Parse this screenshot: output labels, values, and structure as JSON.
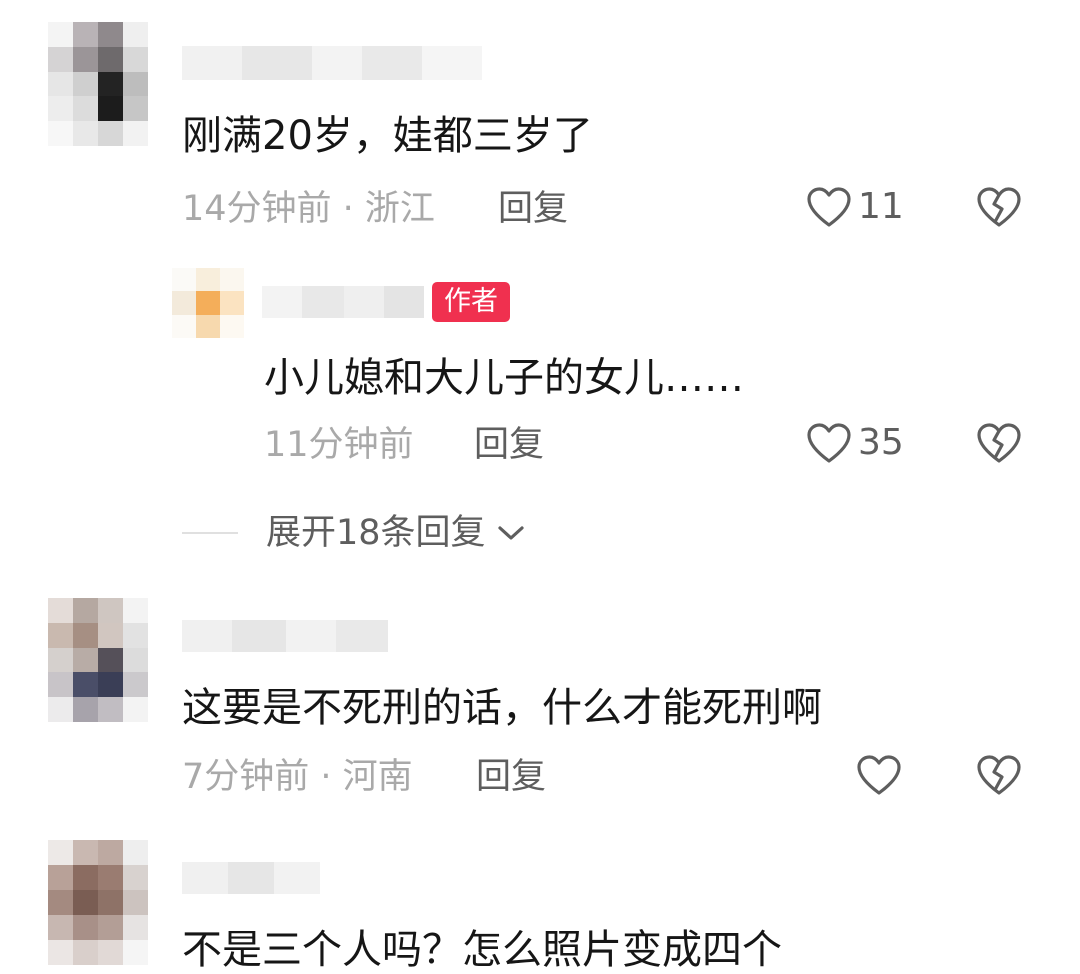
{
  "comments": [
    {
      "text": "刚满20岁，娃都三岁了",
      "meta": "14分钟前 · 浙江",
      "reply_label": "回复",
      "likes": "11",
      "replies": [
        {
          "badge": "作者",
          "text": "小儿媳和大儿子的女儿……",
          "meta": "11分钟前",
          "reply_label": "回复",
          "likes": "35"
        }
      ],
      "expand_label": "展开18条回复"
    },
    {
      "text": "这要是不死刑的话，什么才能死刑啊",
      "meta": "7分钟前 · 河南",
      "reply_label": "回复",
      "likes": ""
    },
    {
      "text": "不是三个人吗？怎么照片变成四个"
    }
  ],
  "icons": {
    "like": "heart-outline-icon",
    "dislike": "broken-heart-icon",
    "expand": "chevron-down-icon"
  },
  "colors": {
    "author_badge": "#f0304f",
    "meta_text": "#a9a9a9",
    "action_text": "#5e5e5e"
  }
}
